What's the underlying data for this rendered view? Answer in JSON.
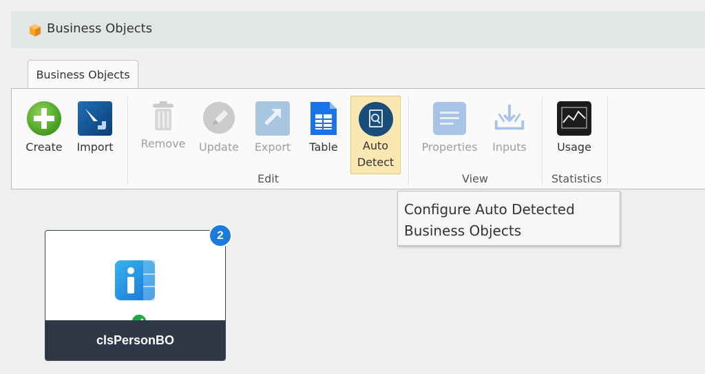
{
  "header": {
    "title": "Business Objects",
    "icon": "cube-icon"
  },
  "tabs": [
    {
      "label": "Business Objects",
      "active": true
    }
  ],
  "ribbon": {
    "buttons": {
      "create": {
        "label": "Create",
        "icon": "plus-circle-icon",
        "enabled": true
      },
      "import": {
        "label": "Import",
        "icon": "import-icon",
        "enabled": true
      },
      "remove": {
        "label": "Remove",
        "icon": "trash-icon",
        "enabled": false
      },
      "update": {
        "label": "Update",
        "icon": "pencil-icon",
        "enabled": false
      },
      "export": {
        "label": "Export",
        "icon": "export-icon",
        "enabled": false
      },
      "table": {
        "label": "Table",
        "icon": "table-icon",
        "enabled": true
      },
      "auto_detect": {
        "label_line1": "Auto",
        "label_line2": "Detect",
        "icon": "auto-detect-icon",
        "enabled": true,
        "highlighted": true
      },
      "properties": {
        "label": "Properties",
        "icon": "properties-icon",
        "enabled": false
      },
      "inputs": {
        "label": "Inputs",
        "icon": "inputs-icon",
        "enabled": false
      },
      "usage": {
        "label": "Usage",
        "icon": "chart-icon",
        "enabled": true
      }
    },
    "groups": {
      "edit": "Edit",
      "view": "View",
      "statistics": "Statistics"
    }
  },
  "tooltip": {
    "line1": "Configure Auto Detected",
    "line2": "Business Objects"
  },
  "card": {
    "name": "clsPersonBO",
    "badge": "2",
    "status": "valid",
    "icon": "info-icon"
  },
  "colors": {
    "accent": "#1d7ad8",
    "highlight": "#fbe7b2",
    "card_footer": "#2e3846",
    "success": "#22a845"
  }
}
